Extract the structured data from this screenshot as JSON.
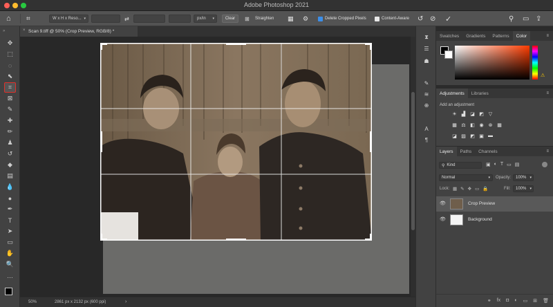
{
  "window": {
    "title": "Adobe Photoshop 2021",
    "traffic_colors": [
      "#ff5f57",
      "#febc2e",
      "#28c840"
    ]
  },
  "options_bar": {
    "ratio_dropdown": "W x H x Reso...",
    "unit_dropdown": "px/in",
    "clear_label": "Clear",
    "straighten_label": "Straighten",
    "delete_cropped_label": "Delete Cropped Pixels",
    "delete_cropped_checked": true,
    "content_aware_label": "Content-Aware",
    "content_aware_checked": false
  },
  "document": {
    "tab_title": "Scan 9.tiff @ 50% (Crop Preview, RGB/8) *",
    "zoom": "50%",
    "status": "2861 px x 2132 px (600 ppi)"
  },
  "tools": [
    {
      "icon": "move-icon",
      "glyph": "✥"
    },
    {
      "icon": "marquee-icon",
      "glyph": "⬚"
    },
    {
      "icon": "lasso-icon",
      "glyph": "◌"
    },
    {
      "icon": "object-select-icon",
      "glyph": "⬉"
    },
    {
      "icon": "crop-icon",
      "glyph": "⌗",
      "active": true
    },
    {
      "icon": "frame-icon",
      "glyph": "⊠"
    },
    {
      "icon": "eyedropper-icon",
      "glyph": "✎"
    },
    {
      "icon": "healing-icon",
      "glyph": "✚"
    },
    {
      "icon": "brush-icon",
      "glyph": "✏"
    },
    {
      "icon": "stamp-icon",
      "glyph": "♟"
    },
    {
      "icon": "history-brush-icon",
      "glyph": "↺"
    },
    {
      "icon": "eraser-icon",
      "glyph": "◆"
    },
    {
      "icon": "gradient-icon",
      "glyph": "▤"
    },
    {
      "icon": "blur-icon",
      "glyph": "💧"
    },
    {
      "icon": "dodge-icon",
      "glyph": "●"
    },
    {
      "icon": "pen-icon",
      "glyph": "✒"
    },
    {
      "icon": "type-icon",
      "glyph": "T"
    },
    {
      "icon": "path-select-icon",
      "glyph": "➤"
    },
    {
      "icon": "shape-icon",
      "glyph": "▭"
    },
    {
      "icon": "hand-icon",
      "glyph": "✋"
    },
    {
      "icon": "zoom-icon",
      "glyph": "🔍"
    },
    {
      "icon": "more-tools-icon",
      "glyph": "…"
    }
  ],
  "color_panel": {
    "tabs": [
      "Swatches",
      "Gradients",
      "Patterns",
      "Color"
    ],
    "active_tab": "Color",
    "hue": "#ff3c00"
  },
  "adjustments_panel": {
    "tabs": [
      "Adjustments",
      "Libraries"
    ],
    "hint": "Add an adjustment"
  },
  "layers_panel": {
    "tabs": [
      "Layers",
      "Paths",
      "Channels"
    ],
    "kind_label": "Kind",
    "blend_mode": "Normal",
    "opacity_label": "Opacity:",
    "opacity_value": "100%",
    "lock_label": "Lock:",
    "fill_label": "Fill:",
    "fill_value": "100%",
    "layers": [
      {
        "name": "Crop Preview",
        "selected": true
      },
      {
        "name": "Background",
        "selected": false
      }
    ]
  }
}
